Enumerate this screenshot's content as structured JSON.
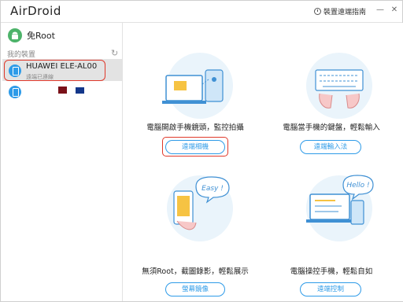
{
  "titlebar": {
    "logo": "AirDroid",
    "guide_label": "裝置遠端指南",
    "minimize_glyph": "—",
    "close_glyph": "✕"
  },
  "sidebar": {
    "root_label": "免Root",
    "section_title": "我的裝置",
    "selected_device": {
      "name": "HUAWEI ELE-AL00",
      "status": "遠端已連線"
    },
    "colors": {
      "highlight": "#e0392b",
      "device_icon": "#2e9be8",
      "root_icon": "#4db36a"
    }
  },
  "features": [
    {
      "description": "電腦開啟手機鏡頭，監控拍攝",
      "button": "遠端相機"
    },
    {
      "description": "電腦當手機的鍵盤，輕鬆輸入",
      "button": "遠端輸入法"
    },
    {
      "description": "無須Root，截圖錄影，輕鬆展示",
      "button": "螢幕鏡像"
    },
    {
      "description": "電腦操控手機，輕鬆自如",
      "button": "遠端控制"
    }
  ],
  "illustration_text": {
    "easy": "Easy !",
    "hello": "Hello !"
  }
}
